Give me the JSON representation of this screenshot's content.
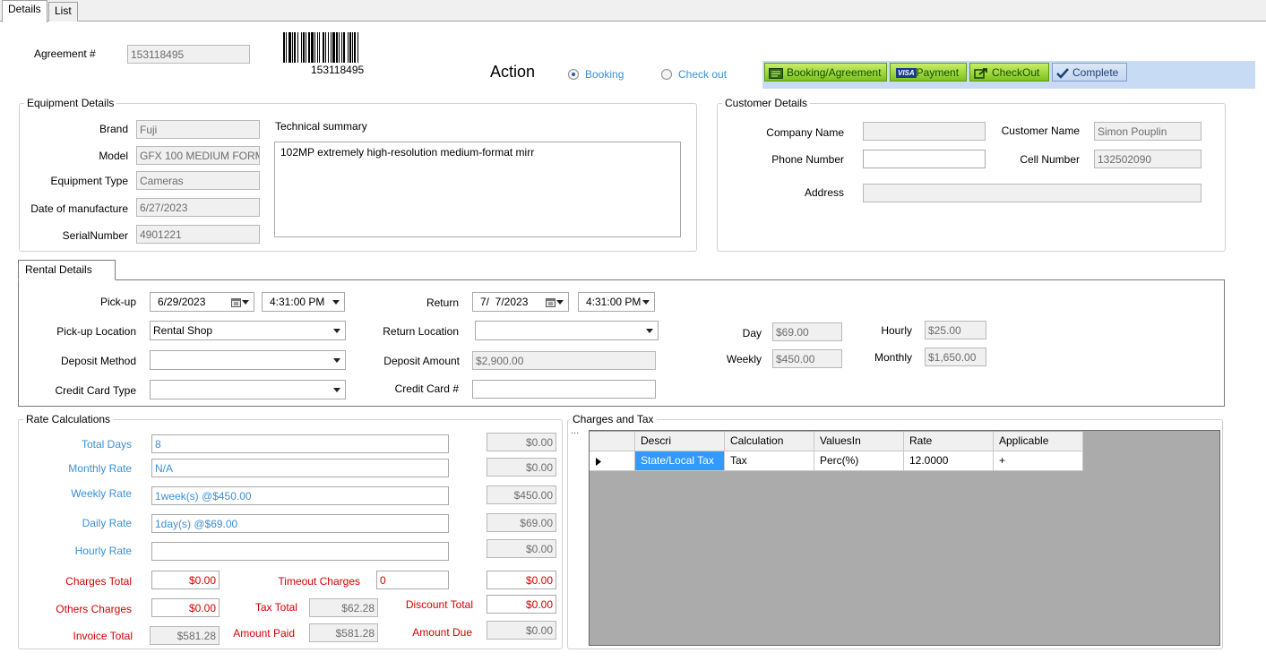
{
  "tabs": [
    "Details",
    "List"
  ],
  "agreement": {
    "label": "Agreement #",
    "value": "153118495",
    "barcode_text": "153118495"
  },
  "action": {
    "title": "Action",
    "options": [
      {
        "label": "Booking",
        "selected": true
      },
      {
        "label": "Check out",
        "selected": false
      }
    ]
  },
  "steps": [
    {
      "label": "Booking/Agreement",
      "icon": "agreement-icon"
    },
    {
      "label": "Payment",
      "icon": "visa-card-icon",
      "icon_text": "VISA"
    },
    {
      "label": "CheckOut",
      "icon": "checkout-arrow-icon"
    },
    {
      "label": "Complete",
      "icon": "checkmark-icon"
    }
  ],
  "equipment": {
    "title": "Equipment Details",
    "brand": {
      "label": "Brand",
      "value": "Fuji"
    },
    "model": {
      "label": "Model",
      "value": "GFX 100 MEDIUM FORM"
    },
    "type": {
      "label": "Equipment Type",
      "value": "Cameras"
    },
    "manufacture": {
      "label": "Date of manufacture",
      "value": "6/27/2023"
    },
    "serial": {
      "label": "SerialNumber",
      "value": "4901221"
    },
    "summary_label": "Technical summary",
    "summary": "102MP extremely high-resolution medium-format mirr"
  },
  "customer": {
    "title": "Customer Details",
    "company": {
      "label": "Company Name",
      "value": ""
    },
    "customer_name": {
      "label": "Customer Name",
      "value": "Simon Pouplin"
    },
    "phone": {
      "label": "Phone Number",
      "value": ""
    },
    "cell": {
      "label": "Cell Number",
      "value": "132502090"
    },
    "address": {
      "label": "Address",
      "value": ""
    }
  },
  "rental": {
    "tab": "Rental Details",
    "pickup": {
      "label": "Pick-up",
      "date": "6/29/2023",
      "time": "4:31:00 PM"
    },
    "return": {
      "label": "Return",
      "date": "7/  7/2023",
      "time": "4:31:00 PM"
    },
    "pickup_location": {
      "label": "Pick-up Location",
      "value": "Rental Shop"
    },
    "return_location": {
      "label": "Return Location",
      "value": ""
    },
    "deposit_method": {
      "label": "Deposit  Method",
      "value": ""
    },
    "deposit_amount": {
      "label": "Deposit  Amount",
      "value": "$2,900.00"
    },
    "card_type": {
      "label": "Credit Card Type",
      "value": ""
    },
    "card_number": {
      "label": "Credit Card #",
      "value": ""
    },
    "day": {
      "label": "Day",
      "value": "$69.00"
    },
    "hourly": {
      "label": "Hourly",
      "value": "$25.00"
    },
    "weekly": {
      "label": "Weekly",
      "value": "$450.00"
    },
    "monthly": {
      "label": "Monthly",
      "value": "$1,650.00"
    }
  },
  "rates": {
    "title": "Rate Calculations",
    "rows": [
      {
        "label": "Total Days",
        "value": "8",
        "amount": "$0.00"
      },
      {
        "label": "Monthly Rate",
        "value": "N/A",
        "amount": "$0.00"
      },
      {
        "label": "Weekly Rate",
        "value": "1week(s) @$450.00",
        "amount": "$450.00"
      },
      {
        "label": "Daily Rate",
        "value": "1day(s) @$69.00",
        "amount": "$69.00"
      },
      {
        "label": "Hourly Rate",
        "value": "",
        "amount": "$0.00"
      }
    ],
    "charges_total": {
      "label": "Charges Total",
      "value": "$0.00"
    },
    "timeout_charges": {
      "label": "Timeout Charges",
      "value": "0",
      "amount": "$0.00"
    },
    "others_charges": {
      "label": "Others Charges",
      "value": "$0.00"
    },
    "tax_total": {
      "label": "Tax Total",
      "value": "$62.28"
    },
    "discount_total": {
      "label": "Discount Total",
      "value": "$0.00"
    },
    "invoice_total": {
      "label": "Invoice Total",
      "value": "$581.28"
    },
    "amount_paid": {
      "label": "Amount Paid",
      "value": "$581.28"
    },
    "amount_due": {
      "label": "Amount Due",
      "value": "$0.00"
    }
  },
  "charges": {
    "title": "Charges and Tax",
    "handle": "...",
    "columns": [
      "Descri",
      "Calculation",
      "ValuesIn",
      "Rate",
      "Applicable"
    ],
    "rows": [
      {
        "cells": [
          "State/Local Tax",
          "Tax",
          "Perc(%)",
          "12.0000",
          "+"
        ]
      }
    ]
  },
  "colors": {
    "label_blue": "#3a8fd6",
    "label_red": "#d40000",
    "step_green": "#7dc21e",
    "grid_bg": "#ababab"
  }
}
